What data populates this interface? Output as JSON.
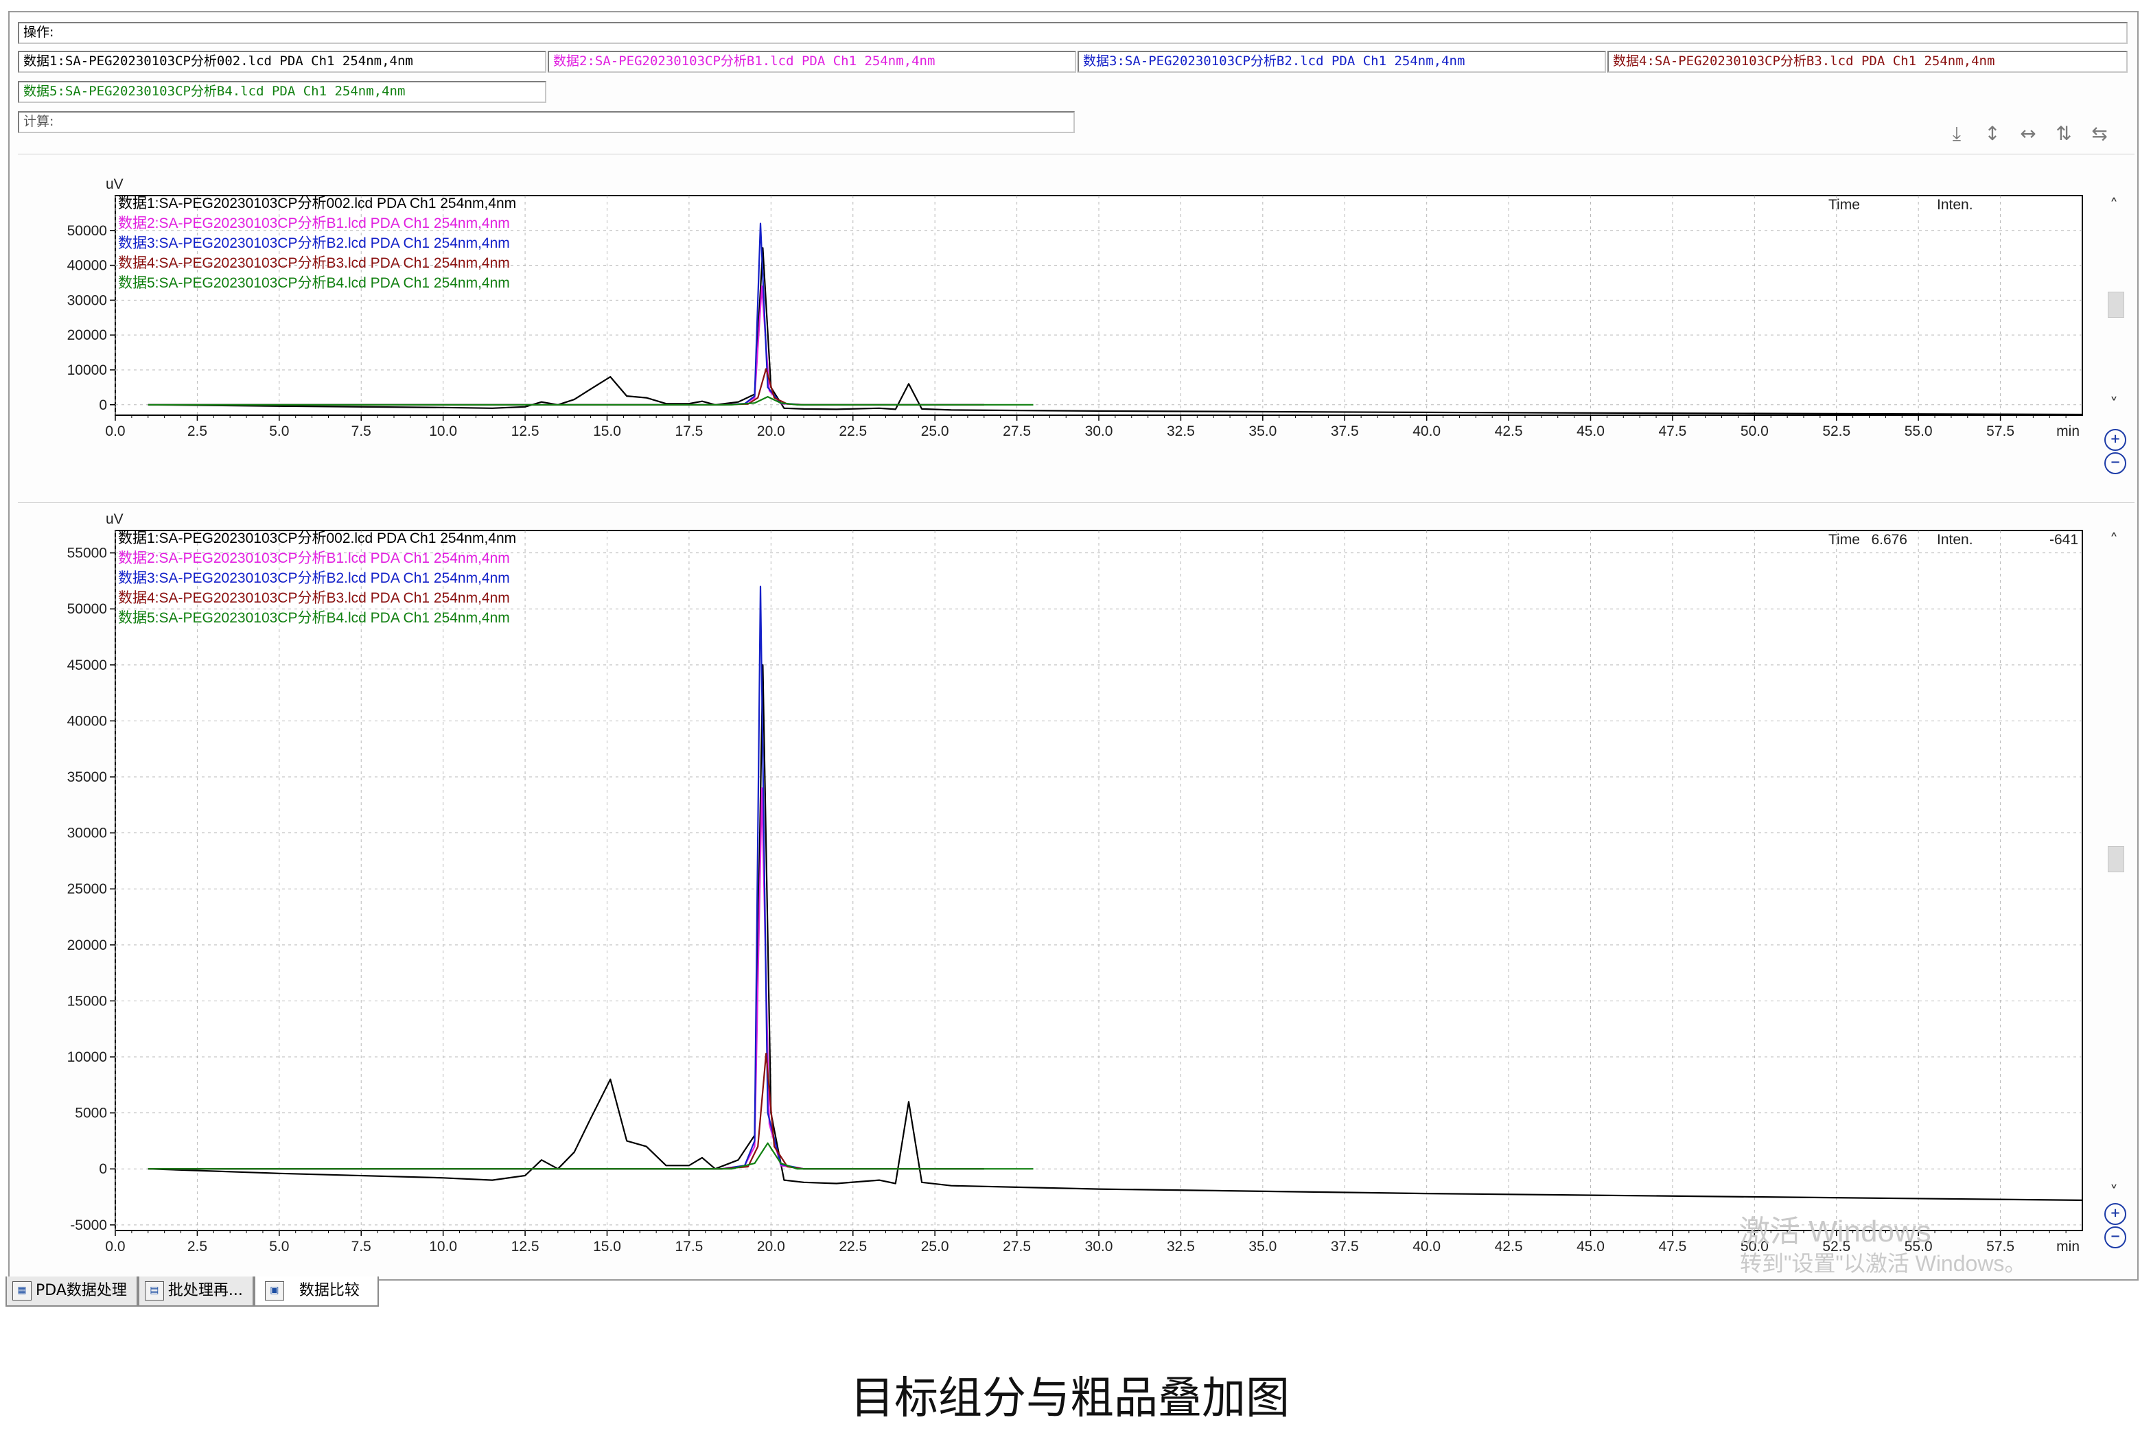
{
  "operations": {
    "label": "操作:"
  },
  "files": [
    {
      "label": "数据1:SA-PEG20230103CP分析002.lcd PDA Ch1 254nm,4nm",
      "color": "#000000"
    },
    {
      "label": "数据2:SA-PEG20230103CP分析B1.lcd PDA Ch1 254nm,4nm",
      "color": "#e020e0"
    },
    {
      "label": "数据3:SA-PEG20230103CP分析B2.lcd PDA Ch1 254nm,4nm",
      "color": "#1420c8"
    },
    {
      "label": "数据4:SA-PEG20230103CP分析B3.lcd PDA Ch1 254nm,4nm",
      "color": "#8a1010"
    },
    {
      "label": "数据5:SA-PEG20230103CP分析B4.lcd PDA Ch1 254nm,4nm",
      "color": "#108010"
    }
  ],
  "calculation": {
    "label": "计算:"
  },
  "toolbar": {
    "icons": [
      "pin-down-icon",
      "expand-vertical-icon",
      "expand-horizontal-icon",
      "sort-vertical-icon",
      "swap-horizontal-icon"
    ]
  },
  "panels": [
    {
      "y_unit": "uV",
      "x_unit": "min",
      "time_label": "Time",
      "time_value": "",
      "inten_label": "Inten.",
      "inten_value": ""
    },
    {
      "y_unit": "uV",
      "x_unit": "min",
      "time_label": "Time",
      "time_value": "6.676",
      "inten_label": "Inten.",
      "inten_value": "-641"
    }
  ],
  "tabs": [
    {
      "label": "PDA数据处理",
      "icon": "pda-icon"
    },
    {
      "label": "批处理再...",
      "icon": "batch-icon"
    },
    {
      "label": "数据比较",
      "icon": "compare-icon"
    }
  ],
  "caption": "目标组分与粗品叠加图",
  "watermark": {
    "line1": "激活 Windows",
    "line2": "转到\"设置\"以激活 Windows。"
  },
  "chart_data": [
    {
      "type": "line",
      "xlabel": "min",
      "ylabel": "uV",
      "xlim": [
        0,
        60
      ],
      "ylim": [
        -3000,
        60000
      ],
      "x_ticks": [
        0.0,
        2.5,
        5.0,
        7.5,
        10.0,
        12.5,
        15.0,
        17.5,
        20.0,
        22.5,
        25.0,
        27.5,
        30.0,
        32.5,
        35.0,
        37.5,
        40.0,
        42.5,
        45.0,
        47.5,
        50.0,
        52.5,
        55.0,
        57.5
      ],
      "y_ticks": [
        0,
        10000,
        20000,
        30000,
        40000,
        50000
      ],
      "grid": true,
      "legend_position": "top-left",
      "series": [
        {
          "name": "数据1:SA-PEG20230103CP分析002.lcd PDA Ch1 254nm,4nm",
          "color": "#000000",
          "x": [
            1.0,
            5.0,
            10.0,
            11.5,
            12.5,
            13.0,
            13.5,
            14.0,
            14.5,
            15.1,
            15.6,
            16.2,
            16.8,
            17.5,
            17.9,
            18.3,
            19.0,
            19.5,
            19.75,
            20.0,
            20.4,
            21.0,
            22.0,
            23.3,
            23.8,
            24.2,
            24.6,
            25.5,
            30.0,
            40.0,
            50.0,
            60.0
          ],
          "y": [
            0,
            -400,
            -800,
            -1000,
            -600,
            800,
            0,
            1500,
            4500,
            8000,
            2500,
            2000,
            300,
            300,
            1000,
            0,
            800,
            3000,
            45000,
            5000,
            -1000,
            -1200,
            -1300,
            -1000,
            -1300,
            6000,
            -1200,
            -1500,
            -1800,
            -2200,
            -2500,
            -2800
          ]
        },
        {
          "name": "数据2:SA-PEG20230103CP分析B1.lcd PDA Ch1 254nm,4nm",
          "color": "#e020e0",
          "x": [
            1.0,
            10.0,
            18.5,
            19.2,
            19.5,
            19.72,
            19.95,
            20.3,
            21.0,
            24.0,
            26.5
          ],
          "y": [
            0,
            0,
            0,
            300,
            2000,
            34000,
            4000,
            300,
            0,
            0,
            0
          ]
        },
        {
          "name": "数据3:SA-PEG20230103CP分析B2.lcd PDA Ch1 254nm,4nm",
          "color": "#1420c8",
          "x": [
            1.0,
            10.0,
            18.5,
            19.2,
            19.5,
            19.68,
            19.9,
            20.3,
            21.0,
            24.0,
            26.5
          ],
          "y": [
            0,
            0,
            0,
            300,
            2500,
            52000,
            5000,
            400,
            0,
            0,
            0
          ]
        },
        {
          "name": "数据4:SA-PEG20230103CP分析B3.lcd PDA Ch1 254nm,4nm",
          "color": "#8a1010",
          "x": [
            1.0,
            10.0,
            18.5,
            19.3,
            19.6,
            19.85,
            20.1,
            20.5,
            21.0,
            26.5
          ],
          "y": [
            0,
            0,
            0,
            200,
            2000,
            10300,
            2000,
            200,
            0,
            0
          ]
        },
        {
          "name": "数据5:SA-PEG20230103CP分析B4.lcd PDA Ch1 254nm,4nm",
          "color": "#108010",
          "x": [
            1.0,
            10.0,
            18.8,
            19.5,
            19.9,
            20.3,
            20.8,
            28.0
          ],
          "y": [
            0,
            0,
            0,
            500,
            2300,
            500,
            0,
            0
          ]
        }
      ]
    },
    {
      "type": "line",
      "xlabel": "min",
      "ylabel": "uV",
      "xlim": [
        0,
        60
      ],
      "ylim": [
        -5500,
        57000
      ],
      "x_ticks": [
        0.0,
        2.5,
        5.0,
        7.5,
        10.0,
        12.5,
        15.0,
        17.5,
        20.0,
        22.5,
        25.0,
        27.5,
        30.0,
        32.5,
        35.0,
        37.5,
        40.0,
        42.5,
        45.0,
        47.5,
        50.0,
        52.5,
        55.0,
        57.5
      ],
      "y_ticks": [
        -5000,
        0,
        5000,
        10000,
        15000,
        20000,
        25000,
        30000,
        35000,
        40000,
        45000,
        50000,
        55000
      ],
      "grid": true,
      "legend_position": "top-left",
      "series_ref": "same as first chart"
    }
  ]
}
